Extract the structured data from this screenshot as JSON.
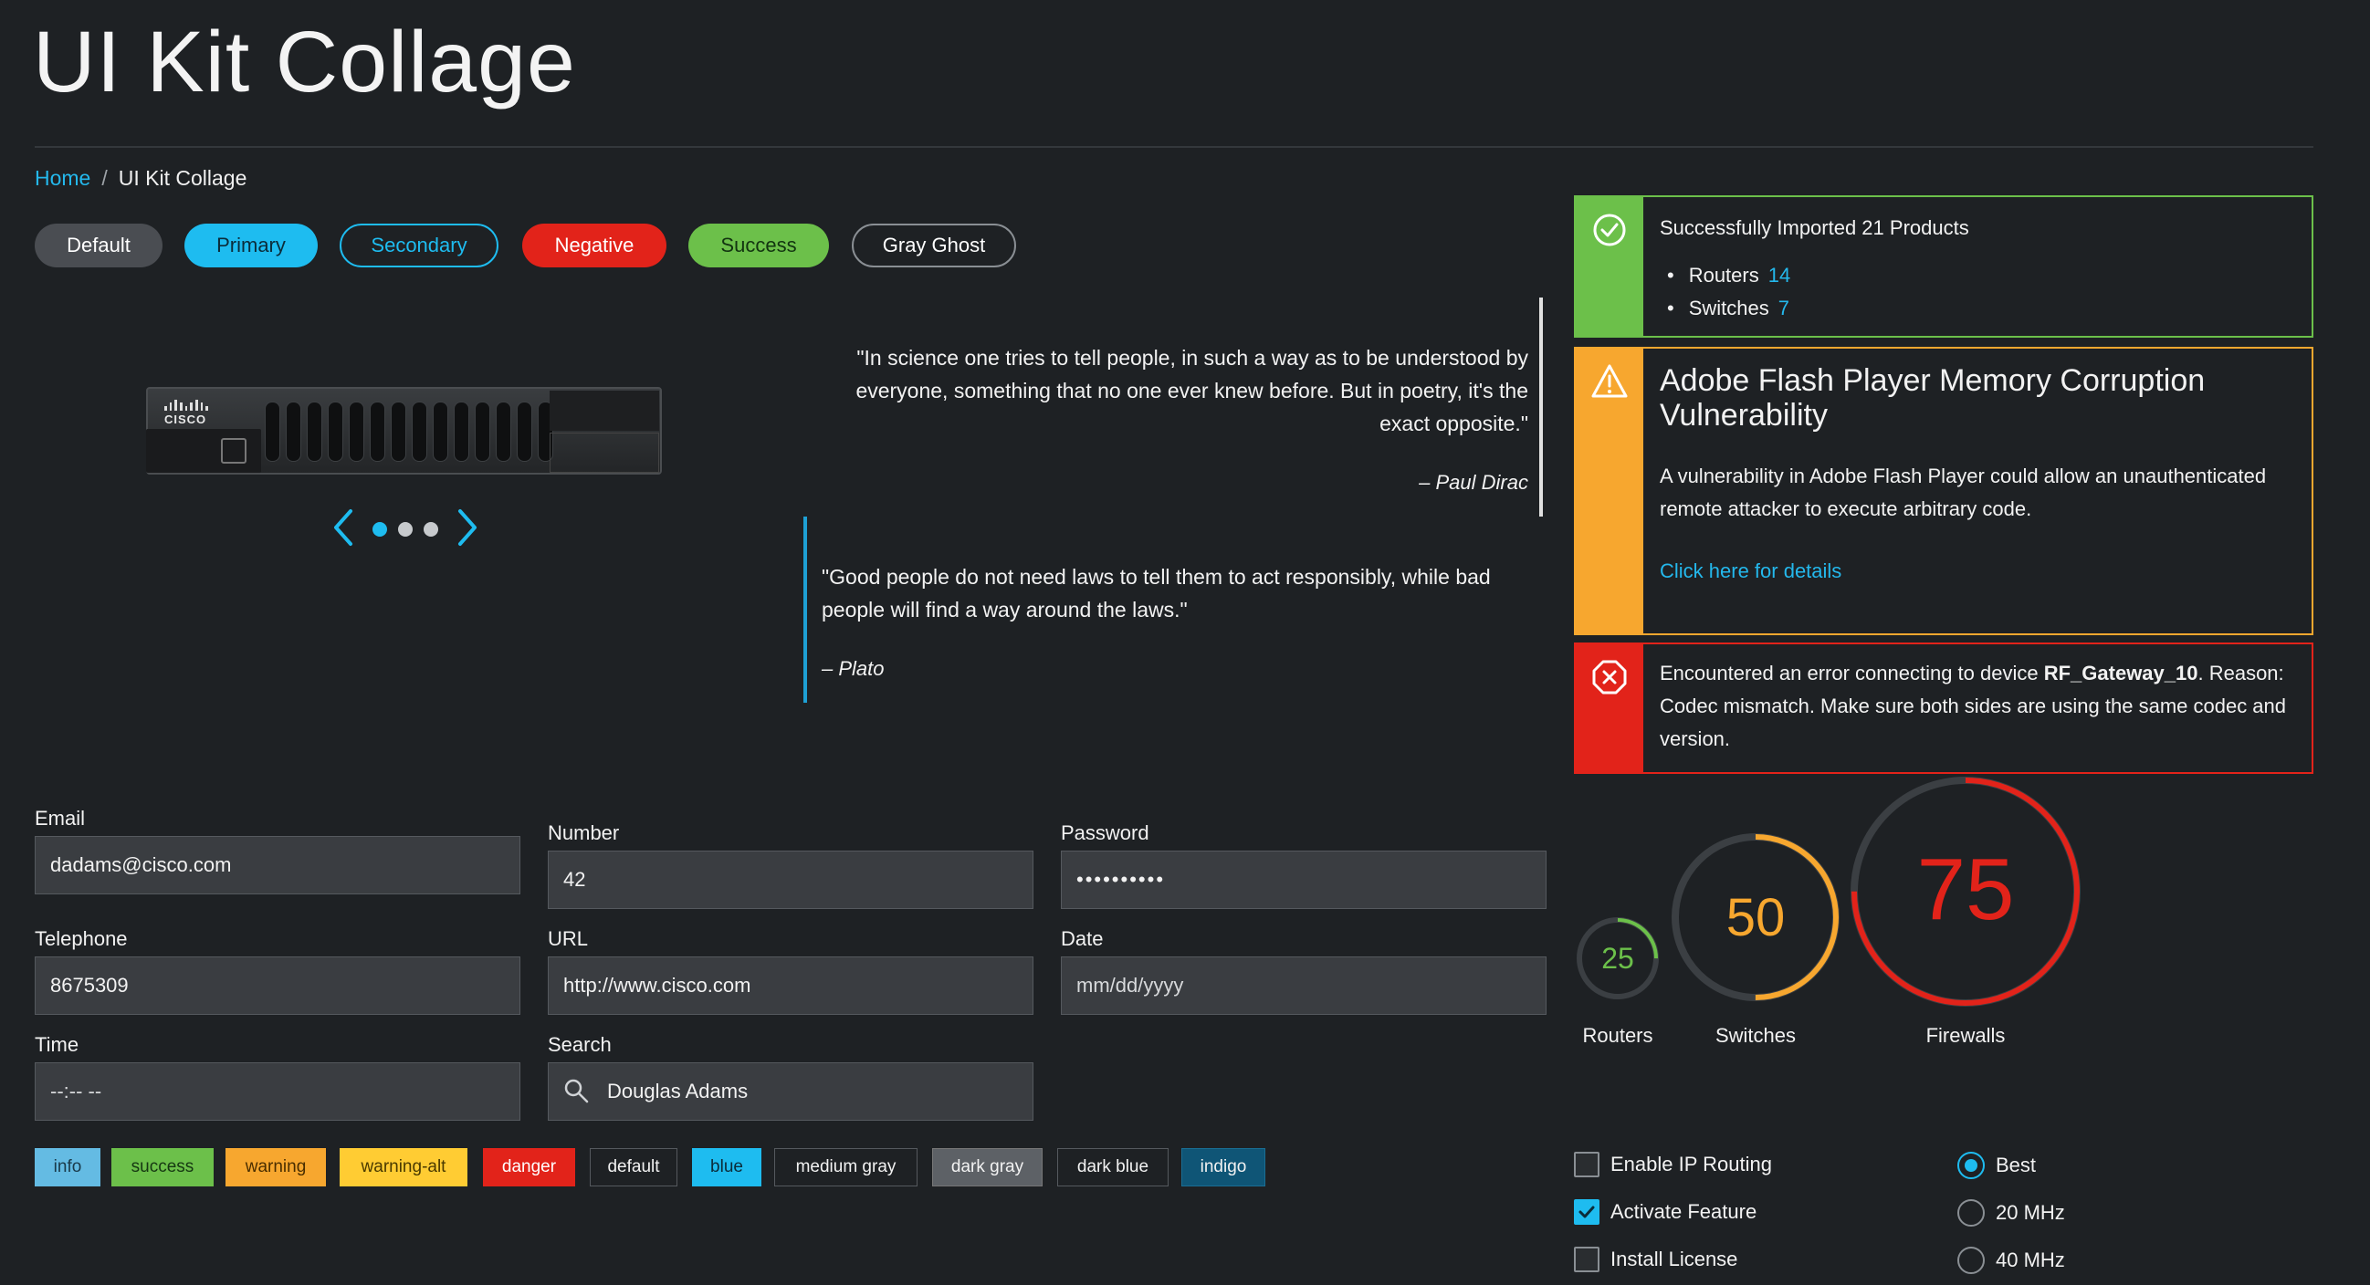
{
  "page": {
    "title": "UI Kit Collage"
  },
  "breadcrumb": {
    "home": "Home",
    "separator": "/",
    "current": "UI Kit Collage"
  },
  "buttons": {
    "default": "Default",
    "primary": "Primary",
    "secondary": "Secondary",
    "negative": "Negative",
    "success": "Success",
    "gray_ghost": "Gray Ghost"
  },
  "carousel": {
    "icons": [
      "chevron-left-icon",
      "chevron-right-icon"
    ],
    "active_index": 1,
    "total": 3
  },
  "quotes": [
    {
      "text": "\"In science one tries to tell people, in such a way as to be understood by everyone, something that no one ever knew before. But in poetry, it's the exact opposite.\"",
      "author": "– Paul Dirac"
    },
    {
      "text": "\"Good people do not need laws to tell them to act responsibly, while bad people will find a way around the laws.\"",
      "author": "– Plato"
    }
  ],
  "alerts": {
    "success": {
      "icon": "check-circle-icon",
      "title": "Successfully Imported 21 Products",
      "items": [
        {
          "label": "Routers",
          "count": "14"
        },
        {
          "label": "Switches",
          "count": "7"
        }
      ]
    },
    "warning": {
      "icon": "warning-triangle-icon",
      "title": "Adobe Flash Player Memory Corruption Vulnerability",
      "body": "A vulnerability in Adobe Flash Player could allow an unauthenticated remote attacker to execute arbitrary code.",
      "link": "Click here for details"
    },
    "danger": {
      "icon": "error-octagon-icon",
      "prefix": "Encountered an error connecting to device ",
      "device": "RF_Gateway_10",
      "suffix": ". Reason: Codec mismatch. Make sure both sides are using the same codec and version."
    }
  },
  "form": {
    "email": {
      "label": "Email",
      "value": "dadams@cisco.com"
    },
    "number": {
      "label": "Number",
      "value": "42"
    },
    "password": {
      "label": "Password",
      "value": "••••••••••"
    },
    "telephone": {
      "label": "Telephone",
      "value": "8675309"
    },
    "url": {
      "label": "URL",
      "value": "http://www.cisco.com"
    },
    "date": {
      "label": "Date",
      "placeholder": "mm/dd/yyyy"
    },
    "time": {
      "label": "Time",
      "placeholder": "--:-- --"
    },
    "search": {
      "label": "Search",
      "value": "Douglas Adams",
      "icon": "search-icon"
    }
  },
  "tags": [
    "info",
    "success",
    "warning",
    "warning-alt",
    "danger",
    "default",
    "blue",
    "medium gray",
    "dark gray",
    "dark blue",
    "indigo"
  ],
  "gauges": [
    {
      "label": "Routers",
      "value": "25",
      "percent": 25,
      "color": "#6cc04a"
    },
    {
      "label": "Switches",
      "value": "50",
      "percent": 50,
      "color": "#f7a72f"
    },
    {
      "label": "Firewalls",
      "value": "75",
      "percent": 75,
      "color": "#e2231a"
    }
  ],
  "checkboxes": [
    {
      "label": "Enable IP Routing",
      "checked": false
    },
    {
      "label": "Activate Feature",
      "checked": true
    },
    {
      "label": "Install License",
      "checked": false
    }
  ],
  "radios": [
    {
      "label": "Best",
      "checked": true
    },
    {
      "label": "20 MHz",
      "checked": false
    },
    {
      "label": "40 MHz",
      "checked": false
    }
  ],
  "colors": {
    "background": "#1e2124",
    "accent": "#1ebcf0",
    "success": "#6cc04a",
    "warning": "#f7a72f",
    "danger": "#e2231a"
  }
}
